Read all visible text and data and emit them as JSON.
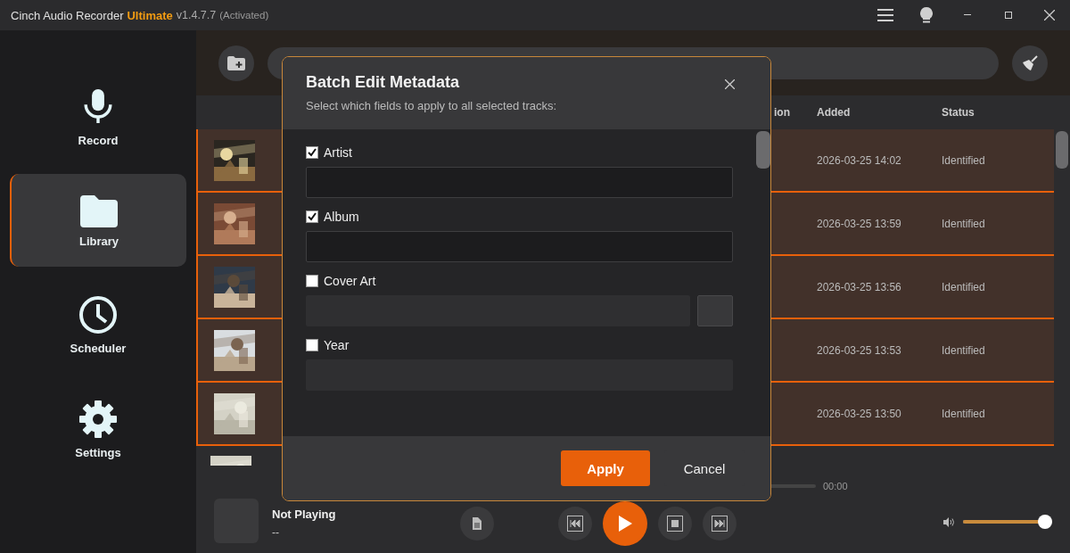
{
  "window": {
    "title": "Cinch Audio Recorder",
    "edition": "Ultimate",
    "version": "v1.4.7.7",
    "status": "(Activated)"
  },
  "sidebar": {
    "items": [
      {
        "label": "Record",
        "selected": false
      },
      {
        "label": "Library",
        "selected": true
      },
      {
        "label": "Scheduler",
        "selected": false
      },
      {
        "label": "Settings",
        "selected": false
      }
    ]
  },
  "table": {
    "columns": [
      "ion",
      "Added",
      "Status"
    ],
    "rows": [
      {
        "added": "2026-03-25 14:02",
        "status": "Identified",
        "selected": true
      },
      {
        "added": "2026-03-25 13:59",
        "status": "Identified",
        "selected": true
      },
      {
        "added": "2026-03-25 13:56",
        "status": "Identified",
        "selected": true
      },
      {
        "added": "2026-03-25 13:53",
        "status": "Identified",
        "selected": true
      },
      {
        "added": "2026-03-25 13:50",
        "status": "Identified",
        "selected": true
      },
      {
        "selected": false
      }
    ]
  },
  "player": {
    "title": "Not Playing",
    "artist": "--",
    "time": "00:00",
    "progress": {
      "level": 0
    },
    "volume": {
      "level": 0.92
    }
  },
  "dialog": {
    "title": "Batch Edit Metadata",
    "subtitle": "Select which fields to apply to all selected tracks:",
    "fields": [
      {
        "label": "Artist",
        "checked": true,
        "kind": "text"
      },
      {
        "label": "Album",
        "checked": true,
        "kind": "text"
      },
      {
        "label": "Cover Art",
        "checked": false
      },
      {
        "label": "Year",
        "checked": false,
        "kind": "text"
      }
    ],
    "apply": "Apply",
    "cancel": "Cancel"
  }
}
